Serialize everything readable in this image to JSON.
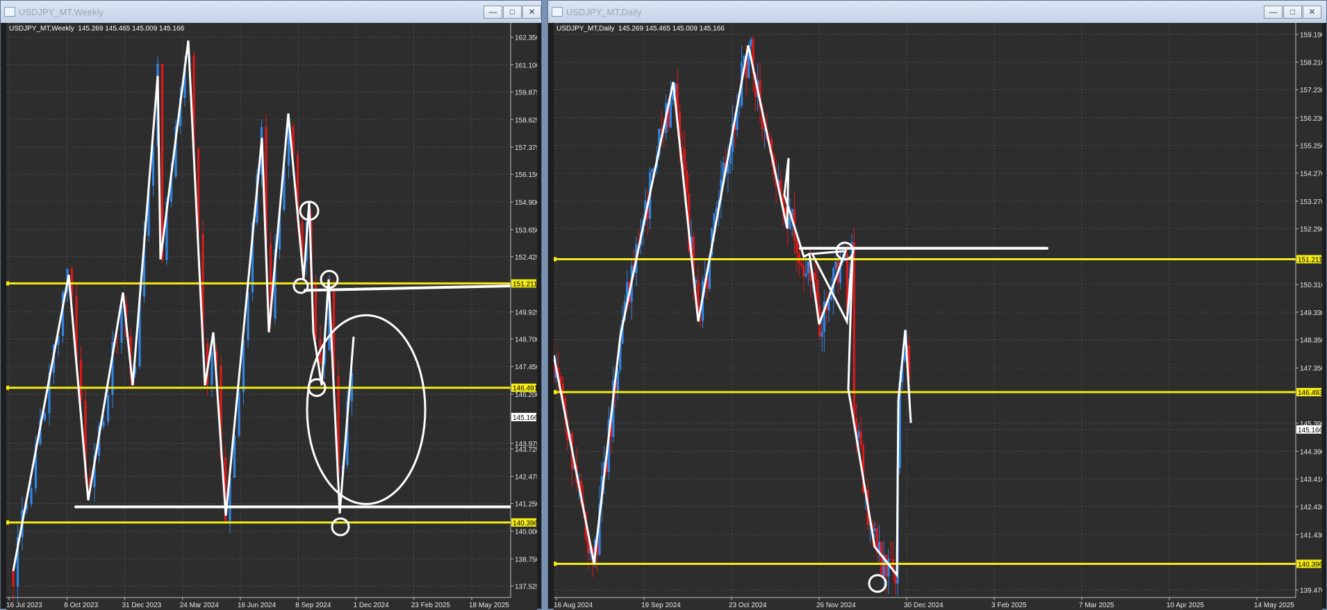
{
  "windows": [
    {
      "title": "USDJPY_MT,Weekly",
      "info": "USDJPY_MT,Weekly  145.269 145.465 145.009 145.166",
      "price_axis": [
        "162.350",
        "161.100",
        "159.875",
        "158.625",
        "157.375",
        "156.150",
        "154.900",
        "153.650",
        "152.425",
        "151.211",
        "149.925",
        "148.700",
        "147.450",
        "146.491",
        "146.200",
        "145.166",
        "143.975",
        "143.725",
        "142.475",
        "141.250",
        "140.396",
        "140.000",
        "138.750",
        "137.525"
      ],
      "date_axis": [
        "16 Jul 2023",
        "8 Oct 2023",
        "31 Dec 2023",
        "24 Mar 2024",
        "16 Jun 2024",
        "8 Sep 2024",
        "1 Dec 2024",
        "23 Feb 2025",
        "18 May 2025"
      ],
      "price_tags": {
        "upper": "151.211",
        "middle": "146.491",
        "lower": "140.396",
        "current": "145.166"
      }
    },
    {
      "title": "USDJPY_MT,Daily",
      "info": "USDJPY_MT,Daily  145.269 145.465 145.009 145.166",
      "price_axis": [
        "159.190",
        "158.210",
        "157.230",
        "156.230",
        "155.250",
        "154.270",
        "153.270",
        "152.290",
        "151.211",
        "150.310",
        "149.330",
        "148.350",
        "147.350",
        "146.493",
        "145.390",
        "145.166",
        "144.390",
        "143.410",
        "142.430",
        "141.430",
        "140.396",
        "139.470"
      ],
      "date_axis": [
        "16 Aug 2024",
        "19 Sep 2024",
        "23 Oct 2024",
        "26 Nov 2024",
        "30 Dec 2024",
        "3 Feb 2025",
        "7 Mar 2025",
        "10 Apr 2025",
        "14 May 2025"
      ],
      "price_tags": {
        "upper": "151.211",
        "middle": "146.493",
        "lower": "140.396",
        "current": "145.166"
      }
    }
  ],
  "colors": {
    "bull": "#2f86e6",
    "bear": "#e01818",
    "level": "#f4ec16",
    "drawing": "#ffffff",
    "background": "#2d2d2d",
    "grid": "#5a5a5a"
  },
  "icons": {
    "minimize": "minimize-icon",
    "maximize": "maximize-icon",
    "close": "close-icon"
  },
  "chart_data": [
    {
      "type": "line",
      "title": "USDJPY_MT,Weekly",
      "x": [
        "16 Jul 2023",
        "8 Oct 2023",
        "31 Dec 2023",
        "24 Mar 2024",
        "16 Jun 2024",
        "8 Sep 2024",
        "1 Dec 2024",
        "23 Feb 2025",
        "18 May 2025"
      ],
      "series": [
        {
          "name": "",
          "values": [
            138.5,
            151.5,
            141.0,
            160.5,
            162.0,
            140.6,
            158.0,
            141.0,
            145.2
          ]
        }
      ],
      "levels": [
        151.211,
        146.491,
        140.396
      ],
      "current_price": 145.166,
      "ylim": [
        137.0,
        163.0
      ]
    },
    {
      "type": "line",
      "title": "USDJPY_MT,Daily",
      "x": [
        "16 Aug 2024",
        "19 Sep 2024",
        "23 Oct 2024",
        "26 Nov 2024",
        "30 Dec 2024",
        "3 Feb 2025",
        "7 Mar 2025",
        "10 Apr 2025",
        "14 May 2025"
      ],
      "series": [
        {
          "name": "",
          "values": [
            148.0,
            140.5,
            157.5,
            149.0,
            158.8,
            151.5,
            146.5,
            140.0,
            145.2
          ]
        }
      ],
      "levels": [
        151.211,
        146.493,
        140.396
      ],
      "current_price": 145.166,
      "ylim": [
        139.2,
        159.6
      ]
    }
  ]
}
